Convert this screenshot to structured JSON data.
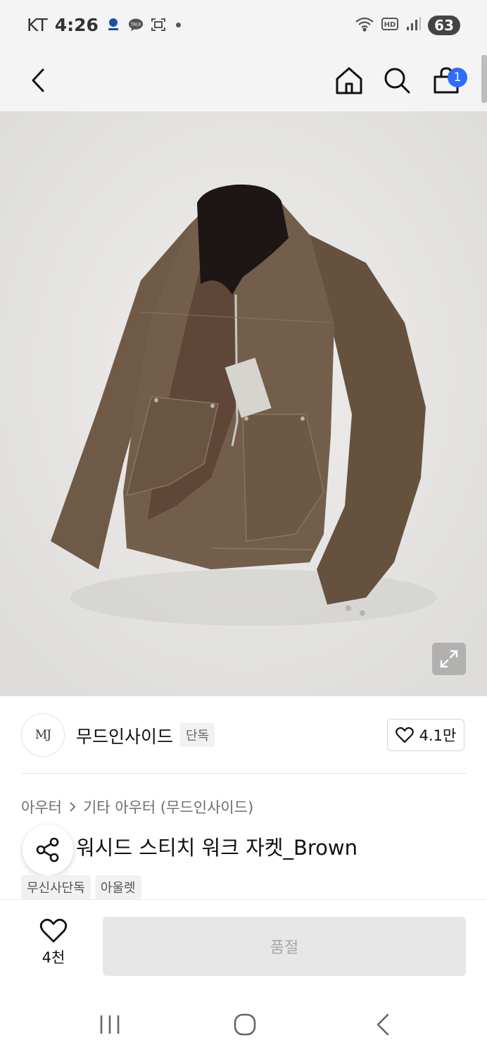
{
  "status_bar": {
    "carrier": "KT",
    "time": "4:26",
    "battery": "63",
    "talk_label": "TALK",
    "network_badge": "HD"
  },
  "nav": {
    "cart_count": "1"
  },
  "brand": {
    "logo_text": "MJ",
    "name": "무드인사이드",
    "tag": "단독",
    "likes": "4.1만"
  },
  "breadcrumb": {
    "category": "아우터",
    "subcategory": "기타 아우터 (무드인사이드)"
  },
  "product": {
    "title": "워시드 스티치 워크 자켓_Brown",
    "tags": [
      "무신사단독",
      "아울렛"
    ]
  },
  "action_bar": {
    "wish_count": "4천",
    "buy_label": "품절"
  },
  "colors": {
    "accent": "#2f6bff",
    "jacket": "#6f5a48",
    "collar": "#1e1614",
    "image_bg": "#e7e6e4"
  },
  "icons": [
    "back-icon",
    "home-icon",
    "search-icon",
    "bag-icon",
    "expand-icon",
    "heart-icon",
    "share-icon",
    "recents-icon",
    "home-circle-icon",
    "nav-back-icon"
  ]
}
